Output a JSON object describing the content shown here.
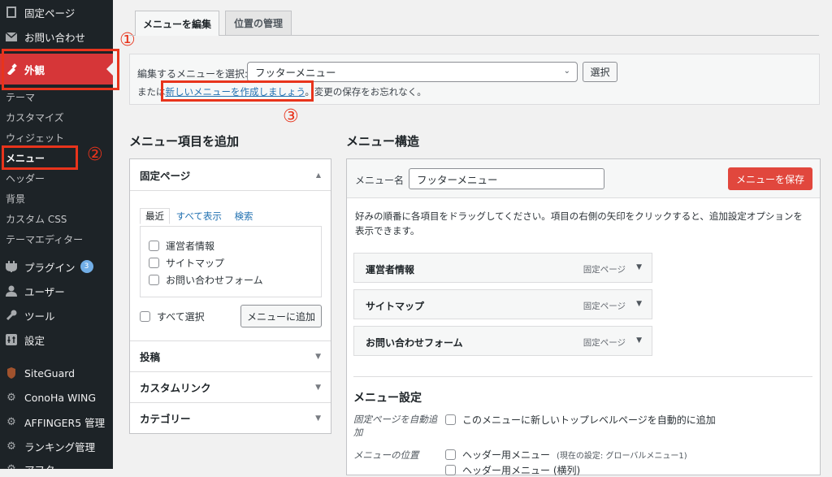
{
  "sidebar": {
    "items": [
      {
        "label": "固定ページ",
        "icon": "page-icon"
      },
      {
        "label": "お問い合わせ",
        "icon": "mail-icon"
      },
      {
        "label": "外観",
        "icon": "brush-icon"
      },
      {
        "label": "プラグイン",
        "icon": "plugin-icon",
        "badge": "3"
      },
      {
        "label": "ユーザー",
        "icon": "user-icon"
      },
      {
        "label": "ツール",
        "icon": "wrench-icon"
      },
      {
        "label": "設定",
        "icon": "settings-icon"
      },
      {
        "label": "SiteGuard",
        "icon": "siteguard-icon"
      },
      {
        "label": "ConoHa WING",
        "icon": "gear-icon"
      },
      {
        "label": "AFFINGER5 管理",
        "icon": "gear-icon"
      },
      {
        "label": "ランキング管理",
        "icon": "gear-icon"
      },
      {
        "label": "アフタ",
        "icon": "gear-icon"
      }
    ],
    "submenu": [
      "テーマ",
      "カスタマイズ",
      "ウィジェット",
      "メニュー",
      "ヘッダー",
      "背景",
      "カスタム CSS",
      "テーマエディター"
    ]
  },
  "annotations": {
    "m1": "①",
    "m2": "②",
    "m3": "③"
  },
  "tabs": {
    "edit": "メニューを編集",
    "locations": "位置の管理"
  },
  "select_menu": {
    "label": "編集するメニューを選択:",
    "value": "フッターメニュー",
    "button": "選択",
    "or_text": "または",
    "create_link": "新しいメニューを作成しましょう",
    "after_text": "。変更の保存をお忘れなく。"
  },
  "add_items": {
    "heading": "メニュー項目を追加",
    "pages": {
      "title": "固定ページ",
      "tabs": [
        "最近",
        "すべて表示",
        "検索"
      ],
      "items": [
        "運営者情報",
        "サイトマップ",
        "お問い合わせフォーム"
      ],
      "select_all": "すべて選択",
      "add_button": "メニューに追加"
    },
    "sections": [
      "投稿",
      "カスタムリンク",
      "カテゴリー"
    ]
  },
  "structure": {
    "heading": "メニュー構造",
    "name_label": "メニュー名",
    "name_value": "フッターメニュー",
    "save_button": "メニューを保存",
    "instructions": "好みの順番に各項目をドラッグしてください。項目の右側の矢印をクリックすると、追加設定オプションを表示できます。",
    "items": [
      {
        "title": "運営者情報",
        "kind": "固定ページ"
      },
      {
        "title": "サイトマップ",
        "kind": "固定ページ"
      },
      {
        "title": "お問い合わせフォーム",
        "kind": "固定ページ"
      }
    ],
    "settings": {
      "heading": "メニュー設定",
      "auto_add_label": "固定ページを自動追加",
      "auto_add_text": "このメニューに新しいトップレベルページを自動的に追加",
      "location_label": "メニューの位置",
      "loc1": "ヘッダー用メニュー",
      "loc1_note": "(現在の設定: グローバルメニュー1)",
      "loc2": "ヘッダー用メニュー (横列)"
    }
  },
  "colors": {
    "accent": "#d63638",
    "annotation": "#e8341c",
    "link": "#2271b1",
    "sidebar": "#1d2327"
  }
}
